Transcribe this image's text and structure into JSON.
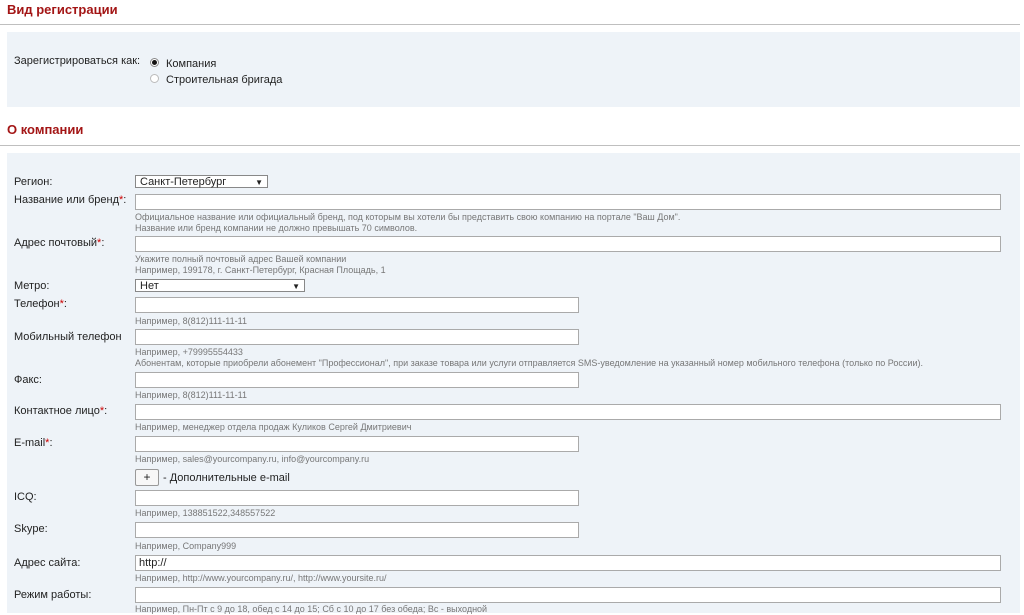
{
  "registration": {
    "title": "Вид регистрации",
    "register_as_label": "Зарегистрироваться как:",
    "options": [
      "Компания",
      "Строительная бригада"
    ],
    "selected": 0
  },
  "company": {
    "title": "О компании",
    "required_mark": "*",
    "region": {
      "label": "Регион:",
      "value": "Санкт-Петербург"
    },
    "name": {
      "label": "Название или бренд",
      "hint1": "Официальное название или официальный бренд, под которым вы хотели бы представить свою компанию на портале \"Ваш Дом\".",
      "hint2": "Название или бренд компании не должно превышать 70 символов."
    },
    "address": {
      "label": "Адрес почтовый",
      "hint1": "Укажите полный почтовый адрес Вашей компании",
      "hint2": "Например, 199178, г. Санкт-Петербург, Красная Площадь, 1"
    },
    "metro": {
      "label": "Метро:",
      "value": "Нет"
    },
    "phone": {
      "label": "Телефон",
      "hint": "Например, 8(812)111-11-11"
    },
    "mobile": {
      "label": "Мобильный телефон",
      "hint1": "Например, +79995554433",
      "hint2": "Абонентам, которые приобрели абонемент \"Профессионал\", при заказе товара или услуги отправляется SMS-уведомление на указанный номер мобильного телефона (только по России)."
    },
    "fax": {
      "label": "Факс:",
      "hint": "Например, 8(812)111-11-11"
    },
    "contact": {
      "label": "Контактное лицо",
      "hint": "Например, менеджер отдела продаж Куликов Сергей Дмитриевич"
    },
    "email": {
      "label": "E-mail",
      "hint": "Например, sales@yourcompany.ru, info@yourcompany.ru"
    },
    "add_email": {
      "button": "+",
      "label": "- Дополнительные e-mail"
    },
    "icq": {
      "label": "ICQ:",
      "hint": "Например, 138851522,348557522"
    },
    "skype": {
      "label": "Skype:",
      "hint": "Например, Company999"
    },
    "site": {
      "label": "Адрес сайта:",
      "value": "http://",
      "hint": "Например, http://www.yourcompany.ru/, http://www.yoursite.ru/"
    },
    "hours": {
      "label": "Режим работы:",
      "hint": "Например, Пн-Пт с 9 до 18, обед с 14 до 15; Сб с 10 до 17 без обеда; Вс - выходной"
    }
  }
}
